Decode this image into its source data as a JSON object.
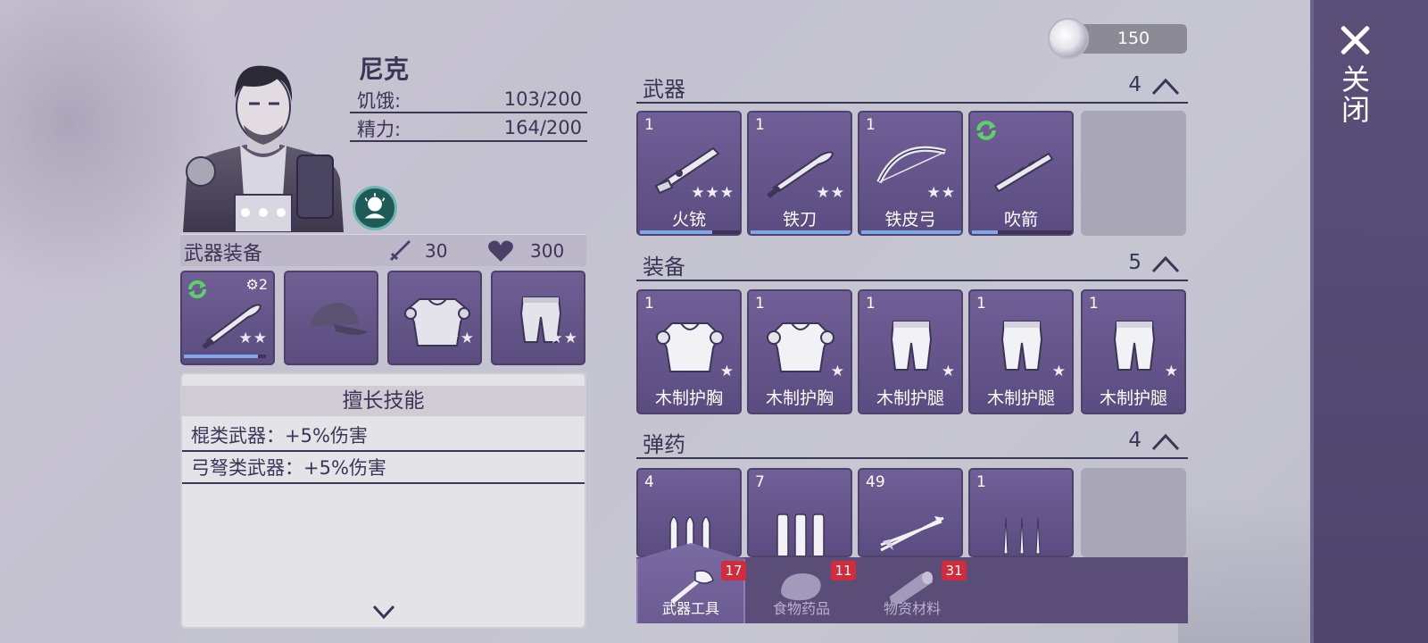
{
  "close": {
    "label": "关闭",
    "icon": "close-icon"
  },
  "currency": {
    "value": "150",
    "icon": "coin-icon"
  },
  "character": {
    "name": "尼克",
    "hunger_label": "饥饿:",
    "hunger_value": "103/200",
    "energy_label": "精力:",
    "energy_value": "164/200",
    "skill_icon": "character-skill-icon"
  },
  "equipment": {
    "title": "武器装备",
    "attack_value": "30",
    "health_value": "300",
    "slots": [
      {
        "name": "weapon-slot",
        "icon": "machete-icon",
        "badge": "2",
        "stars": "★★",
        "durability": 0.9,
        "upgradeable": true
      },
      {
        "name": "head-slot",
        "icon": "cap-icon",
        "badge": "",
        "stars": "",
        "durability": null,
        "upgradeable": false
      },
      {
        "name": "body-slot",
        "icon": "chest-armor-icon",
        "badge": "",
        "stars": "★★",
        "durability": null,
        "upgradeable": false
      },
      {
        "name": "legs-slot",
        "icon": "leg-armor-icon",
        "badge": "",
        "stars": "★★",
        "durability": null,
        "upgradeable": false
      }
    ]
  },
  "skills": {
    "title": "擅长技能",
    "lines": [
      "棍类武器：+5%伤害",
      "弓弩类武器：+5%伤害"
    ]
  },
  "inventory": {
    "weapons": {
      "title": "武器",
      "count": "4",
      "items": [
        {
          "qty": "1",
          "name": "火铳",
          "stars": "★★★",
          "icon": "musket-icon",
          "durability": 0.72,
          "upgradeable": false
        },
        {
          "qty": "1",
          "name": "铁刀",
          "stars": "★★",
          "icon": "machete-icon",
          "durability": 1.0,
          "upgradeable": false
        },
        {
          "qty": "1",
          "name": "铁皮弓",
          "stars": "★★",
          "icon": "bow-icon",
          "durability": 1.0,
          "upgradeable": false
        },
        {
          "qty": "",
          "name": "吹箭",
          "stars": "",
          "icon": "blowpipe-icon",
          "durability": 0.26,
          "upgradeable": true
        }
      ]
    },
    "gear": {
      "title": "装备",
      "count": "5",
      "items": [
        {
          "qty": "1",
          "name": "木制护胸",
          "stars": "★",
          "icon": "chest-armor-icon"
        },
        {
          "qty": "1",
          "name": "木制护胸",
          "stars": "★",
          "icon": "chest-armor-icon"
        },
        {
          "qty": "1",
          "name": "木制护腿",
          "stars": "★",
          "icon": "leg-armor-icon"
        },
        {
          "qty": "1",
          "name": "木制护腿",
          "stars": "★",
          "icon": "leg-armor-icon"
        },
        {
          "qty": "1",
          "name": "木制护腿",
          "stars": "★",
          "icon": "leg-armor-icon"
        }
      ]
    },
    "ammo": {
      "title": "弹药",
      "count": "4",
      "items": [
        {
          "qty": "4",
          "icon": "bullets-icon"
        },
        {
          "qty": "7",
          "icon": "shells-icon"
        },
        {
          "qty": "49",
          "icon": "arrows-icon"
        },
        {
          "qty": "1",
          "icon": "darts-icon"
        }
      ]
    }
  },
  "tabs": [
    {
      "label": "武器工具",
      "badge": "17",
      "icon": "axe-tool-icon",
      "active": true
    },
    {
      "label": "食物药品",
      "badge": "11",
      "icon": "meat-icon",
      "active": false
    },
    {
      "label": "物资材料",
      "badge": "31",
      "icon": "log-icon",
      "active": false
    }
  ],
  "colors": {
    "panel_purple": "#6a5b8f",
    "accent_blue": "#7fa7ea",
    "badge_red": "#d22b3b",
    "refresh_green": "#5fcf6a"
  }
}
